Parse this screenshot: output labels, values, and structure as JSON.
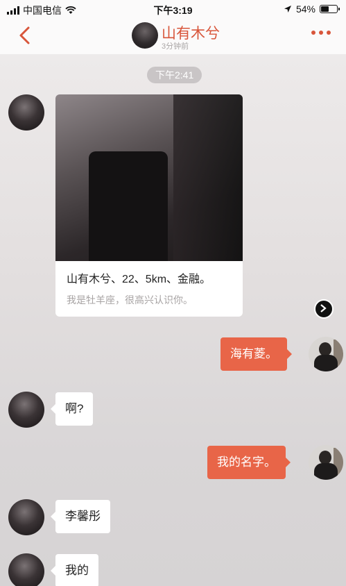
{
  "status_bar": {
    "carrier": "中国电信",
    "time": "下午3:19",
    "battery": "54%",
    "battery_level": 0.54
  },
  "nav": {
    "title": "山有木兮",
    "subtitle": "3分钟前",
    "back_icon": "chevron-left-icon",
    "more_icon": "more-dots-icon"
  },
  "chat": {
    "timestamp": "下午2:41",
    "profile_card": {
      "line1": "山有木兮、22、5km、金融。",
      "line2": "我是牡羊座，很高兴认识你。"
    },
    "messages": [
      {
        "side": "right",
        "text": "海有菱。"
      },
      {
        "side": "left",
        "text": "啊?"
      },
      {
        "side": "right",
        "text": "我的名字。"
      },
      {
        "side": "left",
        "text": "李馨彤"
      },
      {
        "side": "left",
        "text": "我的"
      }
    ]
  },
  "colors": {
    "accent": "#d8553a",
    "bubble_out": "#e86548"
  }
}
